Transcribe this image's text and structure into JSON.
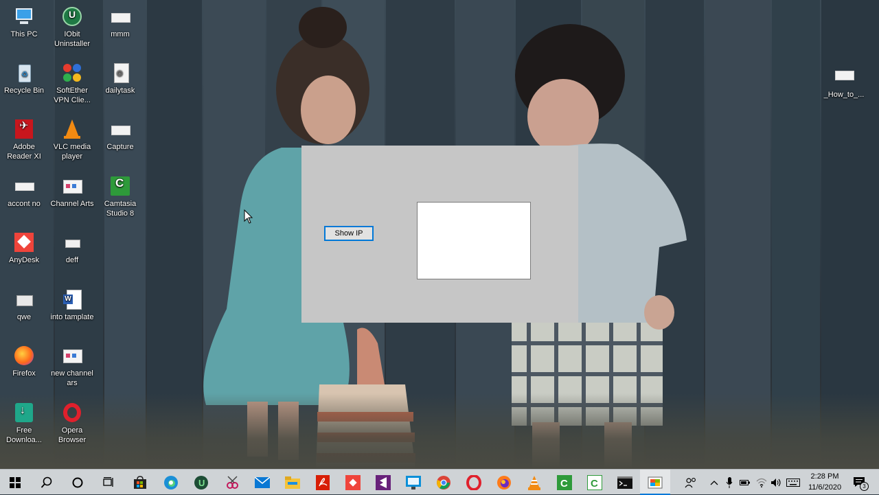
{
  "desktop": {
    "icons": [
      {
        "label": "This PC"
      },
      {
        "label": "IObit Uninstaller"
      },
      {
        "label": "mmm"
      },
      {
        "label": "Recycle Bin"
      },
      {
        "label": "SoftEther VPN Clie..."
      },
      {
        "label": "dailytask"
      },
      {
        "label": "Adobe Reader XI"
      },
      {
        "label": "VLC media player"
      },
      {
        "label": "Capture"
      },
      {
        "label": "accont no"
      },
      {
        "label": "Channel Arts"
      },
      {
        "label": "Camtasia Studio 8"
      },
      {
        "label": "AnyDesk"
      },
      {
        "label": "deff"
      },
      {
        "label": "qwe"
      },
      {
        "label": "into tamplate"
      },
      {
        "label": "Firefox"
      },
      {
        "label": "new channel ars"
      },
      {
        "label": "Free Downloa..."
      },
      {
        "label": "Opera Browser"
      },
      {
        "label": "_How_to_..."
      }
    ]
  },
  "app": {
    "show_ip_label": "Show IP",
    "output_text": ""
  },
  "taskbar": {
    "apps": [
      "start-icon",
      "search-icon",
      "cortana-icon",
      "task-view-icon",
      "store-icon",
      "edge-icon",
      "iobit-icon",
      "snipping-icon",
      "mail-icon",
      "file-explorer-icon",
      "acrobat-icon",
      "anydesk-icon",
      "visual-studio-icon",
      "remote-desktop-icon",
      "chrome-icon",
      "opera-icon",
      "firefox-icon",
      "vlc-icon",
      "camtasia-icon",
      "camtasia-recorder-icon",
      "cmd-icon",
      "app-window-icon"
    ]
  },
  "tray": {
    "time": "2:28 PM",
    "date": "11/6/2020",
    "notification_count": "3"
  }
}
